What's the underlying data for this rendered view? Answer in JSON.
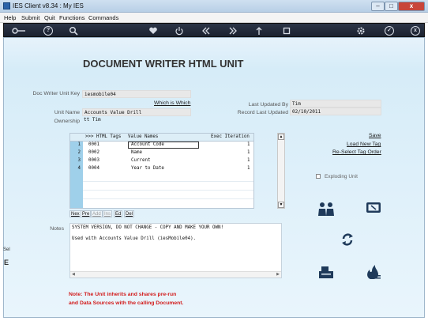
{
  "window": {
    "title": "IES Client v8.34 : My IES",
    "min": "–",
    "max": "□",
    "close": "x"
  },
  "menu": [
    "Help",
    "Submit",
    "Quit",
    "Functions",
    "Commands"
  ],
  "toolbar": {
    "icons": [
      "key-icon",
      "help-icon",
      "search-icon",
      "heart-icon",
      "power-icon",
      "rewind-icon",
      "fast-forward-icon",
      "upload-icon",
      "stop-icon",
      "gear-icon",
      "check-icon",
      "close-icon"
    ],
    "help": "?",
    "check": "✓",
    "close": "x"
  },
  "page": {
    "title": "DOCUMENT WRITER HTML UNIT"
  },
  "form": {
    "unit_key_label": "Doc Writer Unit Key",
    "unit_key_value": "iesmobile04",
    "which_is_which": "Which is Which",
    "unit_name_label": "Unit Name",
    "unit_name_value": "Accounts Value Drill",
    "ownership_label": "Ownership",
    "ownership_value": "tt Tim",
    "last_updated_by_label": "Last Updated By",
    "last_updated_by_value": "Tim",
    "record_last_updated_label": "Record Last Updated",
    "record_last_updated_value": "02/10/2011"
  },
  "actions": {
    "save": "Save",
    "load_new_tag": "Load New Tag",
    "reselect_tag_order": "Re-Select Tag Order",
    "exploding_unit": "Exploding Unit"
  },
  "grid": {
    "headers": [
      ">>> HTML Tags",
      "Value Names",
      "Exec Iteration"
    ],
    "rows": [
      {
        "n": "1",
        "tag": "0001",
        "value": "Account Code",
        "iter": "1"
      },
      {
        "n": "2",
        "tag": "0002",
        "value": "Name",
        "iter": "1"
      },
      {
        "n": "3",
        "tag": "0003",
        "value": "Current",
        "iter": "1"
      },
      {
        "n": "4",
        "tag": "0004",
        "value": "Year to Date",
        "iter": "1"
      }
    ],
    "nav": [
      "Nex",
      "Pre",
      "Add",
      "Ins",
      "Ed",
      "Del"
    ]
  },
  "notes": {
    "label": "Notes",
    "line1": "SYSTEM VERSION, DO NOT CHANGE - COPY AND MAKE YOUR OWN!",
    "line2": "Used with Accounts Value Drill (iesMobile04)."
  },
  "footnote": {
    "line1": "Note: The Unit inherits and shares pre-run",
    "line2": "and Data Sources with the calling Document."
  },
  "side": {
    "text1": "Sel",
    "text2": "E"
  },
  "colors": {
    "toolbar": "#1f2736",
    "accent_row": "#9fd0ea",
    "footnote": "#d21a1a"
  }
}
